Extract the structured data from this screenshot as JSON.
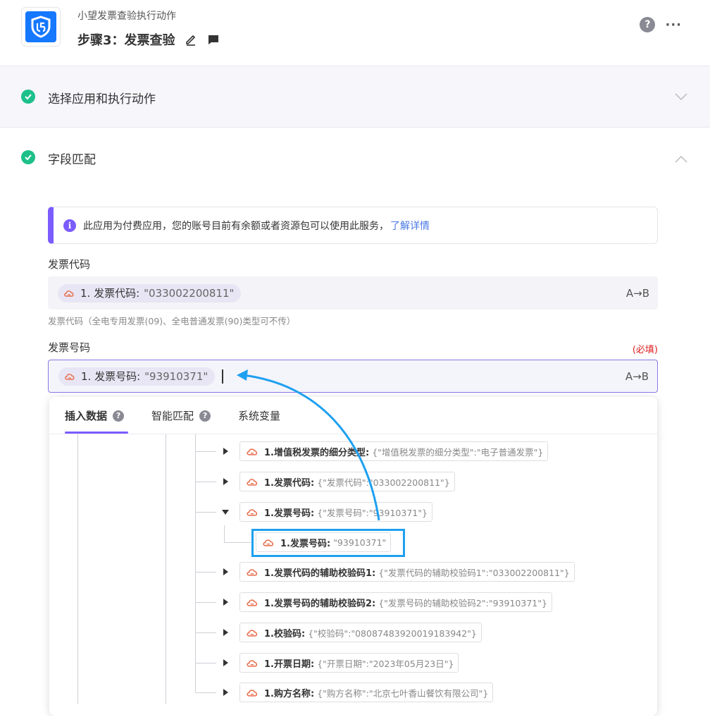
{
  "header": {
    "app_name": "小望发票查验执行动作",
    "step_title": "步骤3：发票查验",
    "help_label": "?",
    "more_label": "···"
  },
  "sections": {
    "select_app": "选择应用和执行动作",
    "field_mapping": "字段匹配"
  },
  "notice": {
    "text": "此应用为付费应用，您的账号目前有余额或者资源包可以使用此服务，",
    "link": "了解详情"
  },
  "fields": [
    {
      "label": "发票代码",
      "chip_name": "1. 发票代码:",
      "chip_value": "\"033002200811\"",
      "mode": "A→B",
      "hint": "发票代码（全电专用发票(09)、全电普通发票(90)类型可不传）"
    },
    {
      "label": "发票号码",
      "required": "(必填)",
      "chip_name": "1. 发票号码:",
      "chip_value": "\"93910371\"",
      "mode": "A→B"
    }
  ],
  "dropdown": {
    "tabs": [
      {
        "label": "插入数据",
        "help": "?"
      },
      {
        "label": "智能匹配",
        "help": "?"
      },
      {
        "label": "系统变量"
      }
    ],
    "nodes": [
      {
        "name": "1.增值税发票的细分类型:",
        "value": "{\"增值税发票的细分类型\":\"电子普通发票\"}"
      },
      {
        "name": "1.发票代码:",
        "value": "{\"发票代码\":\"033002200811\"}"
      },
      {
        "name": "1.发票号码:",
        "value": "{\"发票号码\":\"93910371\"}"
      },
      {
        "name": "1.发票号码:",
        "value": "\"93910371\""
      },
      {
        "name": "1.发票代码的辅助校验码1:",
        "value": "{\"发票代码的辅助校验码1\":\"033002200811\"}"
      },
      {
        "name": "1.发票号码的辅助校验码2:",
        "value": "{\"发票号码的辅助校验码2\":\"93910371\"}"
      },
      {
        "name": "1.校验码:",
        "value": "{\"校验码\":\"08087483920019183942\"}"
      },
      {
        "name": "1.开票日期:",
        "value": "{\"开票日期\":\"2023年05月23日\"}"
      },
      {
        "name": "1.购方名称:",
        "value": "{\"购方名称\":\"北京七叶香山餐饮有限公司\"}"
      }
    ]
  },
  "colors": {
    "accent": "#7a5cff",
    "success": "#1ec08a",
    "highlight": "#1ea0f0",
    "brand": "#1677ff"
  }
}
